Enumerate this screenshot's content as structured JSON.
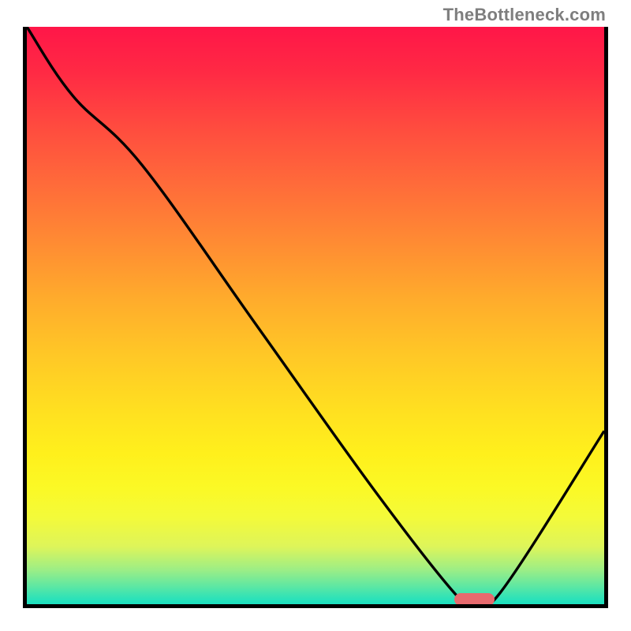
{
  "watermark": "TheBottleneck.com",
  "colors": {
    "gradient_top": "#ff1648",
    "gradient_bottom": "#1ce0c0",
    "curve": "#000000",
    "marker": "#e76a6e",
    "axis": "#000000"
  },
  "chart_data": {
    "type": "line",
    "title": "",
    "xlabel": "",
    "ylabel": "",
    "xlim": [
      0,
      100
    ],
    "ylim": [
      0,
      100
    ],
    "x": [
      0,
      8,
      20,
      40,
      60,
      74,
      77,
      82,
      100
    ],
    "values": [
      100,
      88,
      76,
      48,
      20,
      2,
      0.5,
      2,
      30
    ],
    "marker": {
      "x_start": 74,
      "x_end": 81,
      "y": 0.8
    },
    "notes": "Black curve over rainbow vertical gradient background; single series; optimum marked by pink capsule near bottom."
  }
}
